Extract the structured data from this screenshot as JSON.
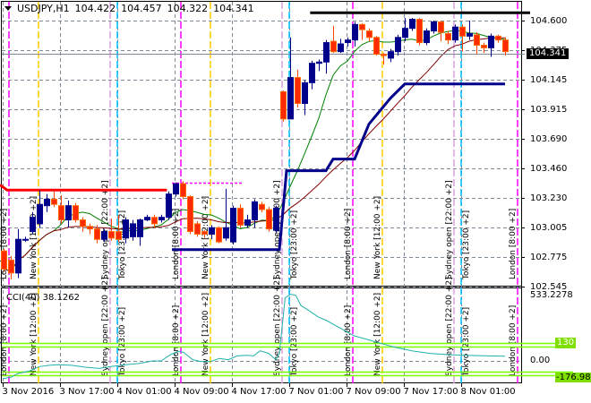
{
  "header": {
    "symbol": "USDJPY,H1",
    "open": "104.422",
    "high": "104.457",
    "low": "104.322",
    "close": "104.341"
  },
  "price_axis": [
    "104.600",
    "104.375",
    "104.145",
    "103.915",
    "103.690",
    "103.460",
    "103.230",
    "103.005",
    "102.775",
    "102.545"
  ],
  "current_price": "104.341",
  "cci": {
    "title": "CCI(40) 38.1262",
    "max_label": "533.2278",
    "zero_label": "0.00",
    "upper_level": "130",
    "min_label": "-176.9836"
  },
  "time_axis": [
    "3 Nov 2016",
    "3 Nov 17:00",
    "4 Nov 01:00",
    "4 Nov 09:00",
    "4 Nov 17:00",
    "7 Nov 01:00",
    "7 Nov 09:00",
    "7 Nov 17:00",
    "8 Nov 01:00"
  ],
  "sessions": {
    "london": "London [8:00 +2]",
    "newyork": "New York [12:00 +2]",
    "sydney": "Sydney open [22:00 +2]",
    "tokyo": "Tokyo [23:00 +2]"
  },
  "colors": {
    "bull": "#00008b",
    "bear": "#ff2a00",
    "fast_ma": "#008000",
    "slow_ma": "#800000",
    "cci": "#20b2aa",
    "levels": "#7cfc00",
    "london": "#ff00ff",
    "newyork": "#ffcc00",
    "sydney": "#dda0dd",
    "tokyo": "#00bfff"
  },
  "chart_data": {
    "type": "candlestick",
    "symbol": "USDJPY",
    "timeframe": "H1",
    "ylim": [
      102.545,
      104.6
    ],
    "candles_ohlc": [
      [
        102.82,
        102.84,
        102.66,
        102.68
      ],
      [
        102.75,
        102.78,
        102.6,
        102.65
      ],
      [
        102.65,
        102.99,
        102.61,
        102.91
      ],
      [
        102.91,
        102.93,
        102.89,
        102.91
      ],
      [
        102.97,
        103.12,
        102.95,
        103.08
      ],
      [
        103.03,
        103.29,
        103.0,
        103.18
      ],
      [
        103.17,
        103.26,
        103.12,
        103.22
      ],
      [
        103.22,
        103.28,
        103.16,
        103.18
      ],
      [
        103.17,
        103.25,
        103.03,
        103.06
      ],
      [
        103.06,
        103.21,
        103.0,
        103.17
      ],
      [
        103.17,
        103.19,
        103.04,
        103.06
      ],
      [
        103.06,
        103.08,
        102.97,
        103.01
      ],
      [
        103.01,
        103.03,
        102.95,
        102.99
      ],
      [
        102.99,
        103.02,
        102.88,
        102.91
      ],
      [
        102.91,
        102.99,
        102.89,
        102.97
      ],
      [
        102.97,
        103.07,
        102.9,
        102.92
      ],
      [
        102.97,
        103.1,
        102.89,
        102.91
      ],
      [
        102.92,
        103.08,
        102.88,
        103.06
      ],
      [
        102.93,
        103.06,
        102.9,
        103.03
      ],
      [
        102.93,
        103.07,
        102.86,
        103.06
      ],
      [
        103.06,
        103.1,
        103.05,
        103.08
      ],
      [
        103.08,
        103.1,
        103.0,
        103.03
      ],
      [
        103.06,
        103.1,
        103.04,
        103.08
      ],
      [
        103.08,
        103.28,
        103.06,
        103.26
      ],
      [
        103.26,
        103.35,
        103.24,
        103.34
      ],
      [
        103.34,
        103.36,
        103.22,
        103.24
      ],
      [
        103.24,
        103.25,
        102.95,
        102.97
      ],
      [
        103.03,
        103.05,
        102.93,
        102.95
      ],
      [
        102.97,
        102.98,
        102.92,
        102.95
      ],
      [
        102.95,
        103.02,
        102.91,
        103.0
      ],
      [
        103.0,
        103.01,
        102.88,
        102.89
      ],
      [
        102.92,
        103.3,
        102.9,
        103.0
      ],
      [
        102.89,
        103.17,
        102.87,
        103.15
      ],
      [
        103.15,
        103.18,
        103.0,
        103.02
      ],
      [
        103.02,
        103.1,
        103.0,
        103.06
      ],
      [
        103.06,
        103.22,
        103.0,
        103.2
      ],
      [
        103.18,
        103.2,
        103.12,
        103.14
      ],
      [
        103.14,
        103.16,
        102.97,
        102.99
      ],
      [
        102.98,
        103.17,
        102.96,
        103.15
      ],
      [
        104.05,
        104.06,
        103.82,
        103.84
      ],
      [
        103.84,
        104.47,
        103.84,
        104.16
      ],
      [
        104.16,
        104.22,
        103.93,
        103.96
      ],
      [
        103.96,
        104.14,
        103.87,
        104.12
      ],
      [
        104.12,
        104.29,
        104.07,
        104.27
      ],
      [
        104.27,
        104.3,
        104.21,
        104.28
      ],
      [
        104.28,
        104.45,
        104.19,
        104.43
      ],
      [
        104.44,
        104.56,
        104.35,
        104.36
      ],
      [
        104.36,
        104.46,
        104.35,
        104.42
      ],
      [
        104.43,
        104.47,
        104.4,
        104.45
      ],
      [
        104.45,
        104.59,
        104.4,
        104.57
      ],
      [
        104.57,
        104.58,
        104.45,
        104.53
      ],
      [
        104.52,
        104.54,
        104.44,
        104.47
      ],
      [
        104.47,
        104.48,
        104.33,
        104.34
      ],
      [
        104.34,
        104.35,
        104.26,
        104.33
      ],
      [
        104.31,
        104.38,
        104.28,
        104.36
      ],
      [
        104.36,
        104.49,
        104.33,
        104.47
      ],
      [
        104.47,
        104.62,
        104.44,
        104.54
      ],
      [
        104.54,
        104.62,
        104.52,
        104.61
      ],
      [
        104.61,
        104.62,
        104.41,
        104.43
      ],
      [
        104.43,
        104.54,
        104.41,
        104.52
      ],
      [
        104.52,
        104.6,
        104.5,
        104.59
      ],
      [
        104.59,
        104.6,
        104.44,
        104.51
      ],
      [
        104.5,
        104.52,
        104.42,
        104.45
      ],
      [
        104.45,
        104.57,
        104.43,
        104.55
      ],
      [
        104.55,
        104.57,
        104.36,
        104.48
      ],
      [
        104.48,
        104.6,
        104.45,
        104.5
      ],
      [
        104.49,
        104.51,
        104.34,
        104.41
      ],
      [
        104.41,
        104.43,
        104.35,
        104.39
      ],
      [
        104.39,
        104.5,
        104.32,
        104.48
      ],
      [
        104.48,
        104.49,
        104.43,
        104.45
      ],
      [
        104.45,
        104.47,
        104.33,
        104.36
      ]
    ],
    "support_line": [
      [
        23.5,
        102.83
      ],
      [
        38.5,
        102.83
      ],
      [
        39.5,
        103.44
      ],
      [
        45,
        103.44
      ],
      [
        46,
        103.53
      ],
      [
        49,
        103.53
      ],
      [
        51,
        103.8
      ],
      [
        54,
        104.0
      ],
      [
        56,
        104.11
      ],
      [
        70,
        104.11
      ]
    ],
    "resistance_line": [
      [
        -0.5,
        103.33
      ],
      [
        0.5,
        103.29
      ],
      [
        22.8,
        103.29
      ]
    ],
    "top_line": [
      [
        42.8,
        104.66
      ],
      [
        73.5,
        104.66
      ]
    ],
    "cci_series": [
      [
        -0.1,
        -140
      ],
      [
        1,
        -130
      ],
      [
        2,
        -100
      ],
      [
        3.6,
        -80
      ],
      [
        5,
        -45
      ],
      [
        6.4,
        -35
      ],
      [
        7.6,
        -30
      ],
      [
        9.5,
        -35
      ],
      [
        11.4,
        -50
      ],
      [
        13.3,
        -60
      ],
      [
        15,
        -45
      ],
      [
        17,
        -30
      ],
      [
        19,
        -20
      ],
      [
        20.8,
        0
      ],
      [
        22,
        0
      ],
      [
        23.3,
        50
      ],
      [
        24.3,
        75
      ],
      [
        25.1,
        70
      ],
      [
        26.4,
        10
      ],
      [
        27.6,
        -5
      ],
      [
        28.9,
        -5
      ],
      [
        30.1,
        20
      ],
      [
        31.4,
        10
      ],
      [
        32.6,
        40
      ],
      [
        33.9,
        45
      ],
      [
        34.9,
        40
      ],
      [
        35.8,
        80
      ],
      [
        37,
        60
      ],
      [
        38,
        10
      ],
      [
        38.5,
        60
      ],
      [
        39.3,
        500
      ],
      [
        40.1,
        530
      ],
      [
        40.8,
        520
      ],
      [
        41.5,
        440
      ],
      [
        42.6,
        400
      ],
      [
        43.9,
        350
      ],
      [
        45.1,
        320
      ],
      [
        47,
        260
      ],
      [
        48.9,
        200
      ],
      [
        50.8,
        170
      ],
      [
        52.6,
        140
      ],
      [
        54.5,
        110
      ],
      [
        57,
        80
      ],
      [
        59.5,
        60
      ],
      [
        62,
        50
      ],
      [
        64.5,
        45
      ],
      [
        67.6,
        40
      ],
      [
        70,
        38
      ]
    ],
    "cci_ylim": [
      -176.9836,
      533.2278
    ],
    "cci_levels": [
      130,
      -100
    ]
  }
}
